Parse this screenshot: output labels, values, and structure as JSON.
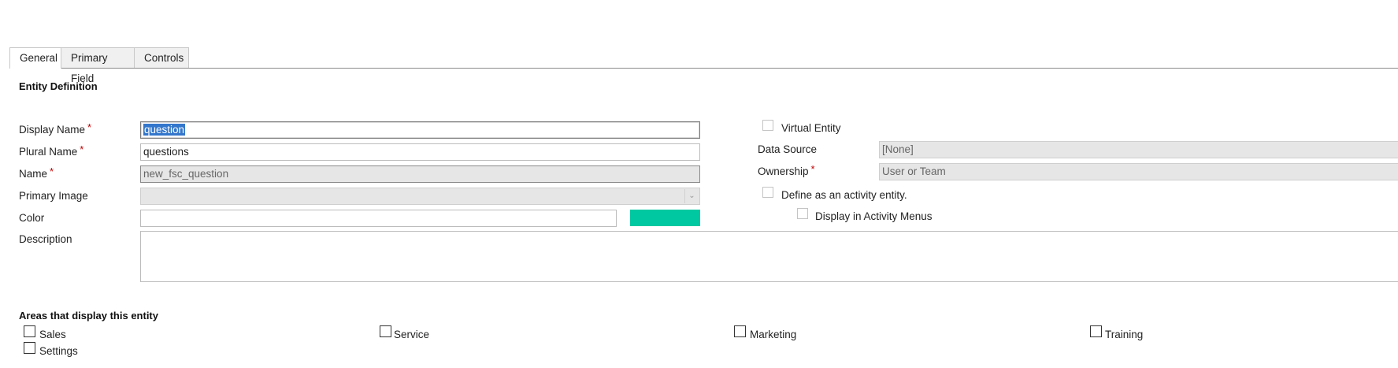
{
  "tabs": [
    {
      "label": "General",
      "active": true
    },
    {
      "label": "Primary Field",
      "active": false
    },
    {
      "label": "Controls",
      "active": false
    }
  ],
  "entity_definition": {
    "title": "Entity Definition",
    "display_name": {
      "label": "Display Name",
      "value": "question",
      "required": "*"
    },
    "plural_name": {
      "label": "Plural Name",
      "value": "questions",
      "required": "*"
    },
    "name": {
      "label": "Name",
      "value": "new_fsc_question",
      "required": "*"
    },
    "primary_image": {
      "label": "Primary Image",
      "value": ""
    },
    "color": {
      "label": "Color",
      "value": "",
      "swatch": "#00c8a0"
    },
    "description": {
      "label": "Description",
      "value": ""
    }
  },
  "right_panel": {
    "virtual_entity": {
      "label": "Virtual Entity",
      "checked": false
    },
    "data_source": {
      "label": "Data Source",
      "value": "[None]"
    },
    "ownership": {
      "label": "Ownership",
      "value": "User or Team",
      "required": "*"
    },
    "activity_entity": {
      "label": "Define as an activity entity.",
      "checked": false
    },
    "activity_menus": {
      "label": "Display in Activity Menus",
      "checked": false
    }
  },
  "areas": {
    "title": "Areas that display this entity",
    "items": [
      {
        "label": "Sales",
        "checked": false
      },
      {
        "label": "Service",
        "checked": false
      },
      {
        "label": "Marketing",
        "checked": false
      },
      {
        "label": "Training",
        "checked": false
      },
      {
        "label": "Settings",
        "checked": false
      }
    ]
  }
}
